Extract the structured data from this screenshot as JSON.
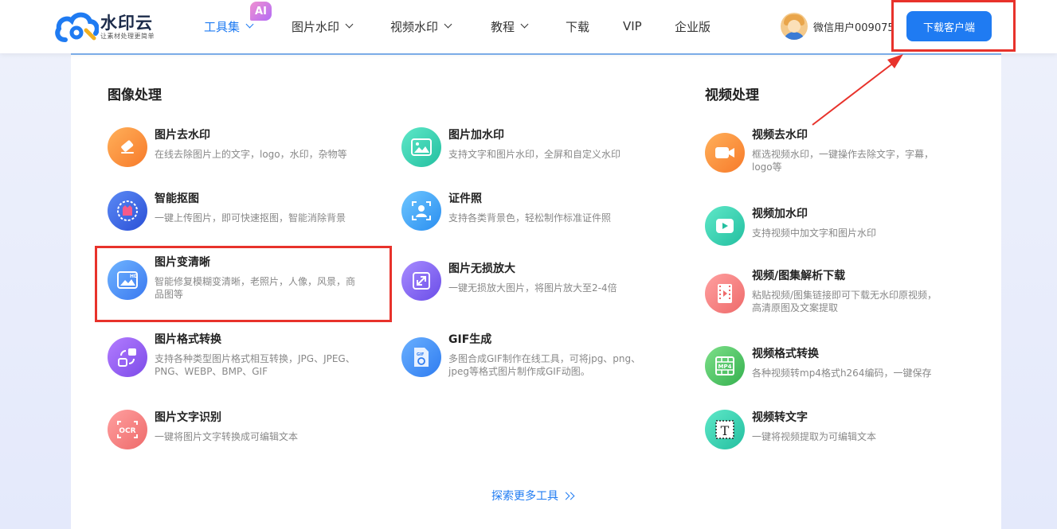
{
  "brand": {
    "title": "水印云",
    "subtitle": "让素材处理更简单"
  },
  "nav": {
    "items": [
      {
        "label": "工具集",
        "dropdown": true,
        "active": true
      },
      {
        "label": "图片水印",
        "dropdown": true
      },
      {
        "label": "视频水印",
        "dropdown": true
      },
      {
        "label": "教程",
        "dropdown": true
      },
      {
        "label": "下载"
      },
      {
        "label": "VIP"
      },
      {
        "label": "企业版"
      }
    ],
    "ai_badge": "AI"
  },
  "user": {
    "name": "微信用户009075"
  },
  "download_button": {
    "label": "下载客户端"
  },
  "panel": {
    "image_section": {
      "title": "图像处理",
      "tools": [
        {
          "name": "图片去水印",
          "desc": "在线去除图片上的文字，logo，水印，杂物等",
          "icon": "eraser-icon",
          "color": "#fb8c3a"
        },
        {
          "name": "图片加水印",
          "desc": "支持文字和图片水印，全屏和自定义水印",
          "icon": "image-frame-icon",
          "color": "#33d0b0"
        },
        {
          "name": "智能抠图",
          "desc": "一键上传图片，即可快速抠图，智能消除背景",
          "icon": "cutout-icon",
          "color": "#3f6fe8"
        },
        {
          "name": "证件照",
          "desc": "支持各类背景色，轻松制作标准证件照",
          "icon": "id-photo-icon",
          "color": "#3aa6f2"
        },
        {
          "name": "图片变清晰",
          "desc_lines": [
            "智能修复模糊变清晰，老照片，人像，风景，商",
            "品图等"
          ],
          "icon": "hd-image-icon",
          "color": "#4a8cf5"
        },
        {
          "name": "图片无损放大",
          "desc": "一键无损放大图片，将图片放大至2-4倍",
          "icon": "expand-icon",
          "color": "#8a5ef0"
        },
        {
          "name": "图片格式转换",
          "desc_lines": [
            "支持各种类型图片格式相互转换，JPG、JPEG、",
            "PNG、WEBP、BMP、GIF"
          ],
          "icon": "format-convert-icon",
          "color": "#9b5ef0"
        },
        {
          "name": "GIF生成",
          "desc_lines": [
            "多图合成GIF制作在线工具，可将jpg、png、",
            "jpeg等格式图片制作成GIF动图。"
          ],
          "icon": "gif-file-icon",
          "color": "#3b8df3"
        },
        {
          "name": "图片文字识别",
          "desc": "一键将图片文字转换成可编辑文本",
          "icon": "ocr-icon",
          "icon_text": "OCR",
          "color": "#f07a7a"
        }
      ]
    },
    "video_section": {
      "title": "视频处理",
      "tools": [
        {
          "name": "视频去水印",
          "desc_lines": [
            "框选视频水印，一键操作去除文字，字幕，",
            "logo等"
          ],
          "icon": "video-camera-icon",
          "color": "#fb8c3a"
        },
        {
          "name": "视频加水印",
          "desc": "支持视频中加文字和图片水印",
          "icon": "video-play-icon",
          "color": "#33d0b0"
        },
        {
          "name": "视频/图集解析下载",
          "desc_lines": [
            "粘贴视频/图集链接即可下载无水印原视频，",
            "高清原图及文案提取"
          ],
          "icon": "film-icon",
          "color": "#f07a7a"
        },
        {
          "name": "视频格式转换",
          "desc": "各种视频转mp4格式h264编码，一键保存",
          "icon": "mp4-icon",
          "icon_text": "MP4",
          "color": "#4cc46a"
        },
        {
          "name": "视频转文字",
          "desc": "一键将视频提取为可编辑文本",
          "icon": "text-t-icon",
          "icon_text": "T",
          "color": "#33d0b0"
        }
      ]
    },
    "more_link": "探索更多工具"
  }
}
